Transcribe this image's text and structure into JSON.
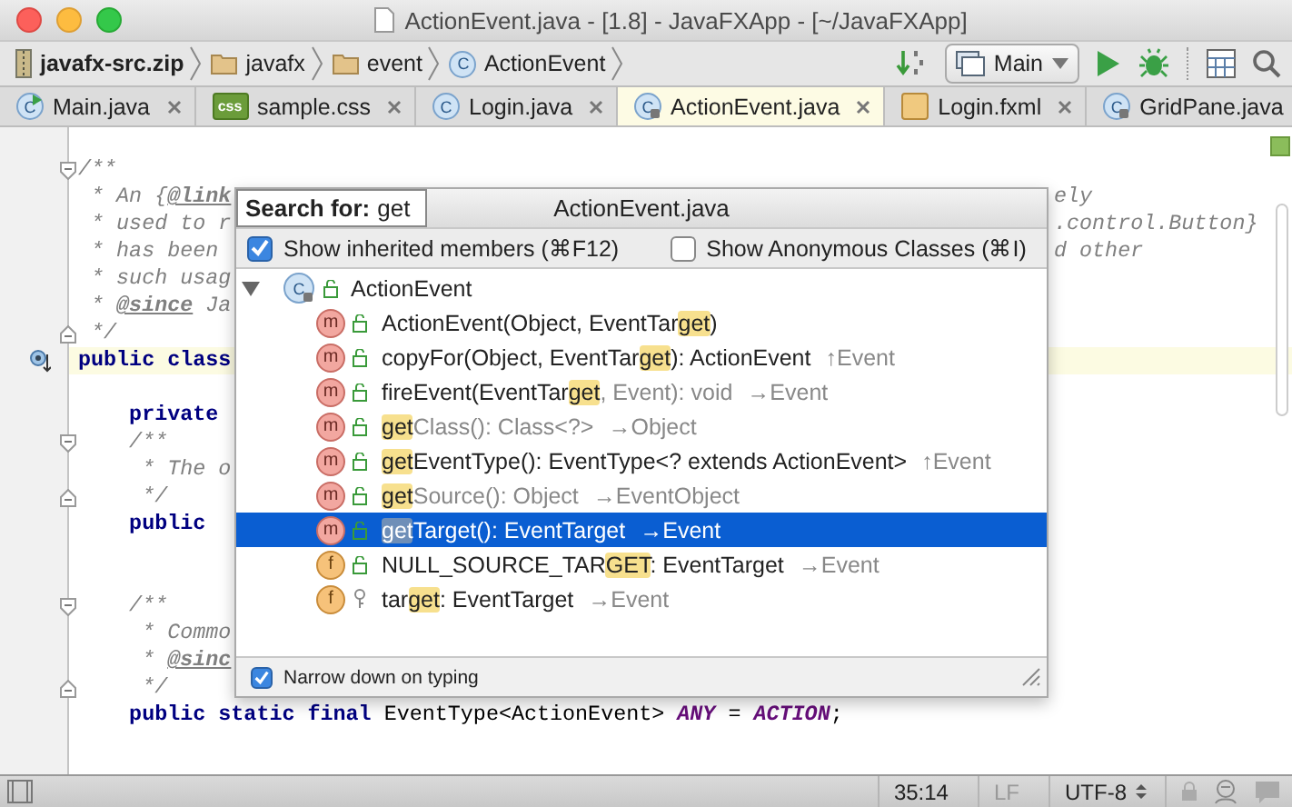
{
  "window": {
    "title": "ActionEvent.java - [1.8] - JavaFXApp - [~/JavaFXApp]"
  },
  "breadcrumbs": [
    {
      "label": "javafx-src.zip",
      "kind": "archive"
    },
    {
      "label": "javafx",
      "kind": "folder"
    },
    {
      "label": "event",
      "kind": "folder"
    },
    {
      "label": "ActionEvent",
      "kind": "class",
      "icon_text": "C"
    }
  ],
  "run_config": {
    "label": "Main"
  },
  "tabs": [
    {
      "label": "Main.java",
      "kind": "runnable",
      "icon_text": "C",
      "selected": false
    },
    {
      "label": "sample.css",
      "kind": "css",
      "icon_text": "css",
      "selected": false
    },
    {
      "label": "Login.java",
      "kind": "class",
      "icon_text": "C",
      "selected": false
    },
    {
      "label": "ActionEvent.java",
      "kind": "locked",
      "icon_text": "C",
      "selected": true
    },
    {
      "label": "Login.fxml",
      "kind": "fxml",
      "selected": false
    },
    {
      "label": "GridPane.java",
      "kind": "locked",
      "icon_text": "C",
      "selected": false
    }
  ],
  "editor": {
    "lines": [
      {
        "kind": "code",
        "fold_start": true,
        "segments": [
          {
            "text": "/**",
            "kind": "comment"
          }
        ]
      },
      {
        "kind": "code",
        "segments": [
          {
            "text": " * An {",
            "kind": "comment"
          },
          {
            "text": "@link",
            "kind": "tag"
          }
        ],
        "right": [
          {
            "text": "ely",
            "kind": "comment"
          }
        ]
      },
      {
        "kind": "code",
        "segments": [
          {
            "text": " * used to r",
            "kind": "comment"
          }
        ],
        "right": [
          {
            "text": ".control.Button}",
            "kind": "comment"
          }
        ]
      },
      {
        "kind": "code",
        "segments": [
          {
            "text": " * has been",
            "kind": "comment"
          }
        ],
        "right": [
          {
            "text": "d other",
            "kind": "comment"
          }
        ]
      },
      {
        "kind": "code",
        "segments": [
          {
            "text": " * such usag",
            "kind": "comment"
          }
        ]
      },
      {
        "kind": "code",
        "segments": [
          {
            "text": " * ",
            "kind": "comment"
          },
          {
            "text": "@since",
            "kind": "tag"
          },
          {
            "text": " Ja",
            "kind": "comment"
          }
        ]
      },
      {
        "kind": "code",
        "fold_end": true,
        "segments": [
          {
            "text": " */",
            "kind": "comment"
          }
        ]
      },
      {
        "kind": "code",
        "highlighted": true,
        "marker": true,
        "segments": [
          {
            "text": "public class",
            "kind": "keyword"
          }
        ]
      },
      {
        "kind": "blank"
      },
      {
        "kind": "code",
        "segments": [
          {
            "text": "    private",
            "kind": "keyword"
          }
        ]
      },
      {
        "kind": "code",
        "fold_start": true,
        "segments": [
          {
            "text": "    /**",
            "kind": "comment"
          }
        ]
      },
      {
        "kind": "code",
        "segments": [
          {
            "text": "     * The o",
            "kind": "comment"
          }
        ]
      },
      {
        "kind": "code",
        "fold_end": true,
        "segments": [
          {
            "text": "     */",
            "kind": "comment"
          }
        ]
      },
      {
        "kind": "code",
        "segments": [
          {
            "text": "    public",
            "kind": "keyword"
          }
        ]
      },
      {
        "kind": "blank"
      },
      {
        "kind": "blank"
      },
      {
        "kind": "code",
        "fold_start": true,
        "segments": [
          {
            "text": "    /**",
            "kind": "comment"
          }
        ]
      },
      {
        "kind": "code",
        "segments": [
          {
            "text": "     * Commo",
            "kind": "comment"
          }
        ]
      },
      {
        "kind": "code",
        "segments": [
          {
            "text": "     * ",
            "kind": "comment"
          },
          {
            "text": "@sinc",
            "kind": "tag"
          }
        ]
      },
      {
        "kind": "code",
        "fold_end": true,
        "segments": [
          {
            "text": "     */",
            "kind": "comment"
          }
        ]
      },
      {
        "kind": "code",
        "segments": [
          {
            "text": "    public static final",
            "kind": "keyword"
          },
          {
            "text": " EventType<ActionEvent> ",
            "kind": "plain"
          },
          {
            "text": "ANY",
            "kind": "constant"
          },
          {
            "text": " = ",
            "kind": "plain"
          },
          {
            "text": "ACTION",
            "kind": "constant"
          },
          {
            "text": ";",
            "kind": "plain"
          }
        ]
      }
    ]
  },
  "popup": {
    "search_label": "Search for:",
    "search_text": "get",
    "title": "ActionEvent.java",
    "options": [
      {
        "label": "Show inherited members (⌘F12)",
        "checked": true
      },
      {
        "label": "Show Anonymous Classes (⌘I)",
        "checked": false
      }
    ],
    "root": {
      "label": "ActionEvent",
      "icon_text": "C",
      "expanded": true,
      "children": [
        {
          "kind": "method",
          "icon_text": "m",
          "public": true,
          "inherited": false,
          "selected": false,
          "segments": [
            {
              "text": "ActionEvent(Object, EventTar",
              "match": false
            },
            {
              "text": "get",
              "match": true
            },
            {
              "text": ")",
              "match": false
            }
          ]
        },
        {
          "kind": "method",
          "icon_text": "m",
          "public": true,
          "inherited": false,
          "selected": false,
          "segments": [
            {
              "text": "copyFor(Object, EventTar",
              "match": false
            },
            {
              "text": "get",
              "match": true
            },
            {
              "text": "): ActionEvent",
              "match": false
            }
          ],
          "origin": "↑Event"
        },
        {
          "kind": "method",
          "icon_text": "m",
          "public": true,
          "inherited": true,
          "selected": false,
          "segments": [
            {
              "text": "fireEvent(EventTar",
              "match": false
            },
            {
              "text": "get",
              "match": true
            },
            {
              "text": ", Event): void",
              "match": false
            }
          ],
          "origin": "→Event"
        },
        {
          "kind": "method",
          "icon_text": "m",
          "public": true,
          "inherited": true,
          "selected": false,
          "segments": [
            {
              "text": "get",
              "match": true
            },
            {
              "text": "Class(): Class<?>",
              "match": false
            }
          ],
          "origin": "→Object"
        },
        {
          "kind": "method",
          "icon_text": "m",
          "public": true,
          "inherited": false,
          "selected": false,
          "segments": [
            {
              "text": "get",
              "match": true
            },
            {
              "text": "EventType(): EventType<? extends ActionEvent>",
              "match": false
            }
          ],
          "origin": "↑Event"
        },
        {
          "kind": "method",
          "icon_text": "m",
          "public": true,
          "inherited": true,
          "selected": false,
          "segments": [
            {
              "text": "get",
              "match": true
            },
            {
              "text": "Source(): Object",
              "match": false
            }
          ],
          "origin": "→EventObject"
        },
        {
          "kind": "method",
          "icon_text": "m",
          "public": true,
          "inherited": false,
          "selected": true,
          "segments": [
            {
              "text": "get",
              "match": true
            },
            {
              "text": "Target(): EventTarget",
              "match": false
            }
          ],
          "origin": "→Event"
        },
        {
          "kind": "field",
          "icon_text": "f",
          "public": true,
          "inherited": false,
          "selected": false,
          "segments": [
            {
              "text": "NULL_SOURCE_TAR",
              "match": false
            },
            {
              "text": "GET",
              "match": true
            },
            {
              "text": ": EventTarget",
              "match": false
            }
          ],
          "origin": "→Event"
        },
        {
          "kind": "field",
          "icon_text": "f",
          "public": false,
          "inherited": false,
          "selected": false,
          "segments": [
            {
              "text": "tar",
              "match": false
            },
            {
              "text": "get",
              "match": true
            },
            {
              "text": ": EventTarget",
              "match": false
            }
          ],
          "origin": "→Event"
        }
      ]
    },
    "footer_option": {
      "label": "Narrow down on typing",
      "checked": true
    }
  },
  "status_bar": {
    "position": "35:14",
    "line_separator": "LF",
    "encoding": "UTF-8"
  }
}
